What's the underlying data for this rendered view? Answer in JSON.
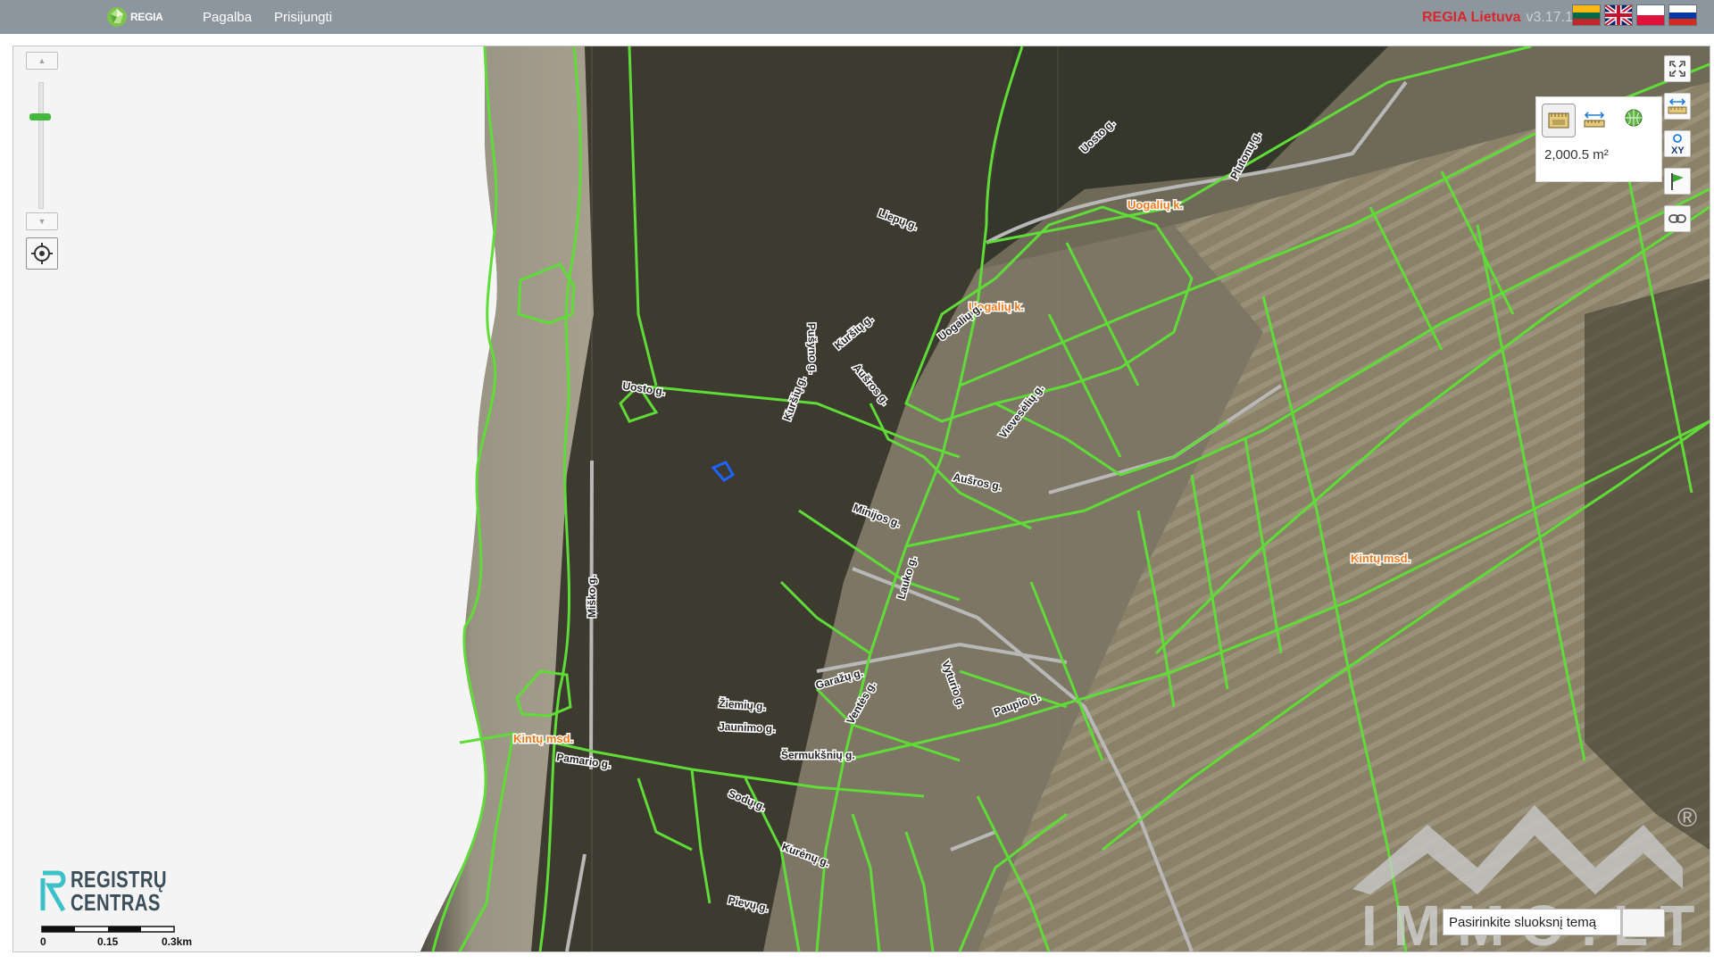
{
  "header": {
    "logo_text": "REGIA",
    "nav": [
      "Pagalba",
      "Prisijungti"
    ],
    "brand_name": "REGIA Lietuva",
    "version": "v3.17.1",
    "languages": [
      "lt-flag-icon",
      "en-flag-icon",
      "pl-flag-icon",
      "ru-flag-icon"
    ]
  },
  "map": {
    "zoom_controls": {
      "up": "zoom-in-arrow-icon",
      "down": "zoom-out-arrow-icon",
      "locate": "locate-icon"
    },
    "toolbar": [
      "fullscreen-icon",
      "measure-distance-icon",
      "xy-coordinates-icon",
      "flag-icon",
      "link-icon"
    ],
    "measure_panel": {
      "tools": [
        "area-ruler-icon",
        "distance-ruler-icon",
        "globe-icon"
      ],
      "value": "2,000.5 m²"
    },
    "search": {
      "placeholder": "Pasirinkite sluoksnį temą"
    },
    "labels": {
      "places": [
        "Uogalių k.",
        "Uogalių k.",
        "Kintų msd.",
        "Kintų msd."
      ],
      "streets": [
        "Uosto g.",
        "Miško g.",
        "Kuršių g.",
        "Aušros g.",
        "Aušros g.",
        "Minijos g.",
        "Lauko g.",
        "Garažų g.",
        "Žiemių g.",
        "Jaunimo g.",
        "Šermukšnių g.",
        "Sodų g.",
        "Pušyno g.",
        "Kurėnų g.",
        "Liepų g.",
        "Vyturio g.",
        "Pievų g.",
        "Paupio g.",
        "Ventės g.",
        "Pamario g.",
        "Kuršių g.",
        "Uogalių g.",
        "Vievesėlių g.",
        "Plutonų g.",
        "Uosto g."
      ]
    },
    "attribution": {
      "logo_lines": [
        "REGISTRŲ",
        "CENTRAS"
      ],
      "scale_labels": [
        "0",
        "0.15",
        "0.3km"
      ]
    },
    "watermark": {
      "text": "IMMO.LT",
      "mark": "®"
    },
    "colors": {
      "parcel": "#5fdc37",
      "selected_parcel": "#1e64ff",
      "place_label": "#f07a1c",
      "brand": "#d9262c"
    }
  }
}
